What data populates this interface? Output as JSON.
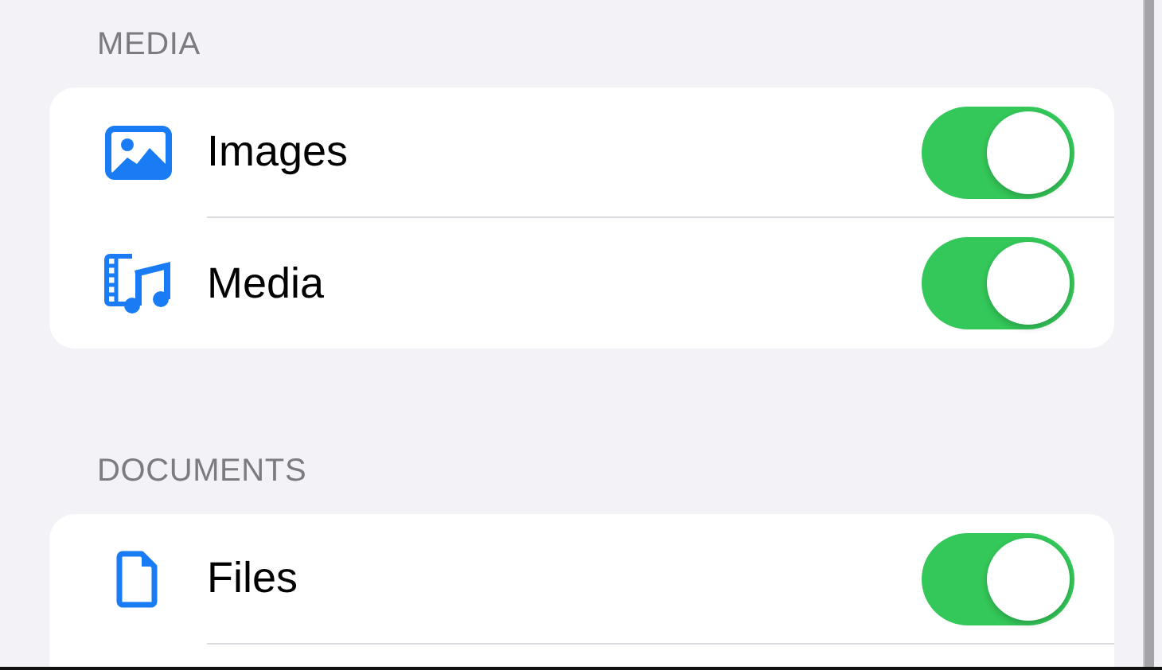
{
  "sections": [
    {
      "header": "MEDIA",
      "continues": false,
      "rows": [
        {
          "kind": "image",
          "label": "Images",
          "on": true
        },
        {
          "kind": "media",
          "label": "Media",
          "on": true
        }
      ]
    },
    {
      "header": "DOCUMENTS",
      "continues": true,
      "rows": [
        {
          "kind": "file",
          "label": "Files",
          "on": true
        }
      ]
    }
  ]
}
